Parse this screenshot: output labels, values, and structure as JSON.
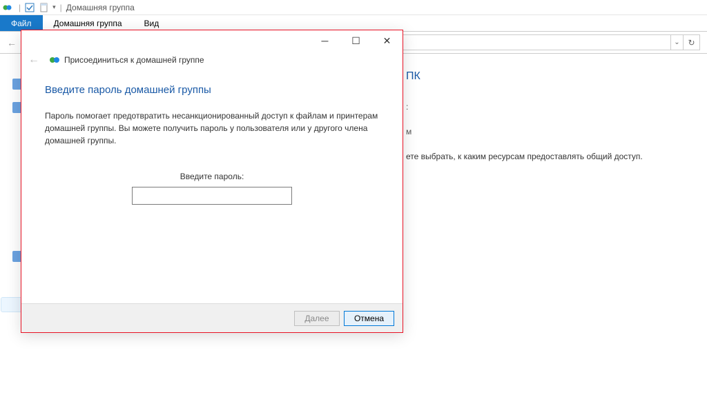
{
  "title_bar": {
    "window_title": "Домашняя группа"
  },
  "ribbon": {
    "tab_file": "Файл",
    "tab_homegroup": "Домашняя группа",
    "tab_view": "Вид"
  },
  "main": {
    "heading_suffix": "ПК",
    "sub1_suffix": ":",
    "sub2_suffix": "м",
    "body_suffix": "ете выбрать, к каким ресурсам предоставлять общий доступ."
  },
  "dialog": {
    "header_title": "Присоединиться к домашней группе",
    "heading": "Введите пароль домашней группы",
    "description": "Пароль помогает предотвратить несанкционированный доступ к файлам и принтерам домашней группы. Вы можете получить пароль у пользователя или у другого члена домашней группы.",
    "prompt": "Введите пароль:",
    "input_value": "",
    "btn_next": "Далее",
    "btn_cancel": "Отмена"
  }
}
